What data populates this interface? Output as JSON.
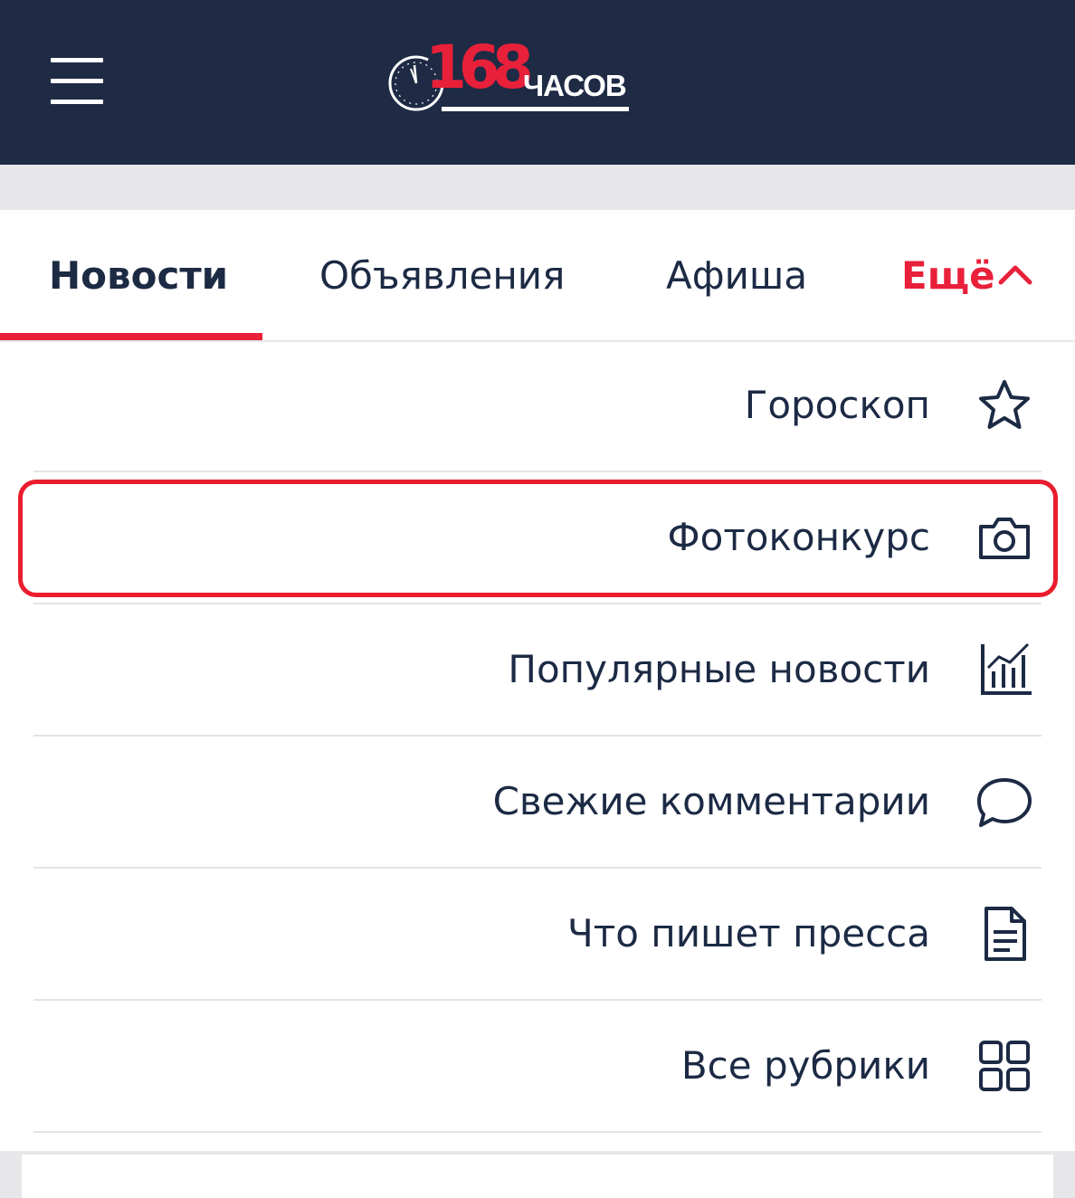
{
  "header": {
    "logo_number": "168",
    "logo_word": "ЧАСОВ",
    "brand_color": "#e8203a",
    "background": "#1f2b45"
  },
  "tabs": [
    {
      "label": "Новости",
      "active": true
    },
    {
      "label": "Объявления",
      "active": false
    },
    {
      "label": "Афиша",
      "active": false
    },
    {
      "label": "Ещё",
      "active": false,
      "icon": "chevron-up-icon"
    }
  ],
  "menu": [
    {
      "label": "Гороскоп",
      "icon": "star-icon"
    },
    {
      "label": "Фотоконкурс",
      "icon": "camera-icon",
      "highlighted": true
    },
    {
      "label": "Популярные новости",
      "icon": "bar-chart-icon"
    },
    {
      "label": "Свежие комментарии",
      "icon": "comment-icon"
    },
    {
      "label": "Что пишет пресса",
      "icon": "document-icon"
    },
    {
      "label": "Все рубрики",
      "icon": "grid-icon"
    }
  ]
}
